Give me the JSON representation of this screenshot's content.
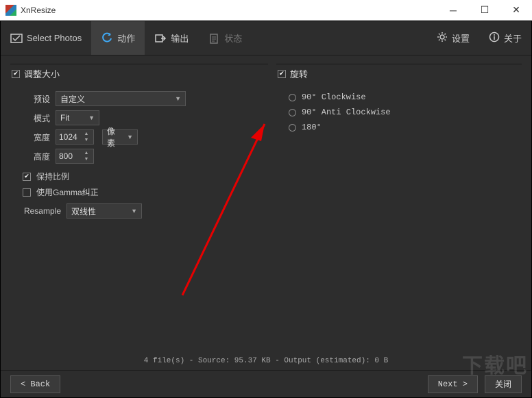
{
  "window": {
    "title": "XnResize"
  },
  "tabs": {
    "select_photos": "Select Photos",
    "actions": "动作",
    "output": "输出",
    "status": "状态"
  },
  "right_menu": {
    "settings": "设置",
    "about": "关于"
  },
  "resize": {
    "header": "调整大小",
    "preset_label": "预设",
    "preset_value": "自定义",
    "mode_label": "模式",
    "mode_value": "Fit",
    "width_label": "宽度",
    "width_value": "1024",
    "height_label": "高度",
    "height_value": "800",
    "unit_value": "像素",
    "keep_ratio": "保持比例",
    "gamma": "使用Gamma纠正",
    "resample_label": "Resample",
    "resample_value": "双线性"
  },
  "rotate": {
    "header": "旋转",
    "opt1": "90° Clockwise",
    "opt2": "90° Anti Clockwise",
    "opt3": "180°"
  },
  "status_text": "4 file(s) - Source: 95.37 KB - Output (estimated): 0 B",
  "buttons": {
    "back": "< Back",
    "next": "Next >",
    "close": "关闭"
  },
  "watermark": "下载吧"
}
